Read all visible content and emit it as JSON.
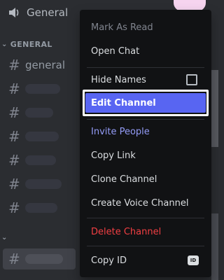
{
  "sidebar": {
    "voice_channel": {
      "name": "General",
      "icon": "speaker-icon"
    },
    "category": {
      "label": "GENERAL",
      "icon": "chevron-down-icon"
    },
    "channels": [
      {
        "name": "general"
      },
      {
        "name": ""
      },
      {
        "name": ""
      },
      {
        "name": ""
      },
      {
        "name": ""
      },
      {
        "name": ""
      },
      {
        "name": ""
      }
    ],
    "collapsed_category": {
      "icon": "chevron-down-icon"
    },
    "selected_channel": {
      "name": ""
    }
  },
  "context_menu": {
    "mark_as_read": "Mark As Read",
    "open_chat": "Open Chat",
    "hide_names": "Hide Names",
    "edit_channel": "Edit Channel",
    "invite_people": "Invite People",
    "copy_link": "Copy Link",
    "clone_channel": "Clone Channel",
    "create_voice_channel": "Create Voice Channel",
    "delete_channel": "Delete Channel",
    "copy_id": "Copy ID",
    "id_badge": "ID"
  },
  "colors": {
    "accent": "#5865f2",
    "invite": "#949cf7",
    "danger": "#f23f43",
    "menu_bg": "#111214",
    "sidebar_bg": "#2b2d31"
  }
}
